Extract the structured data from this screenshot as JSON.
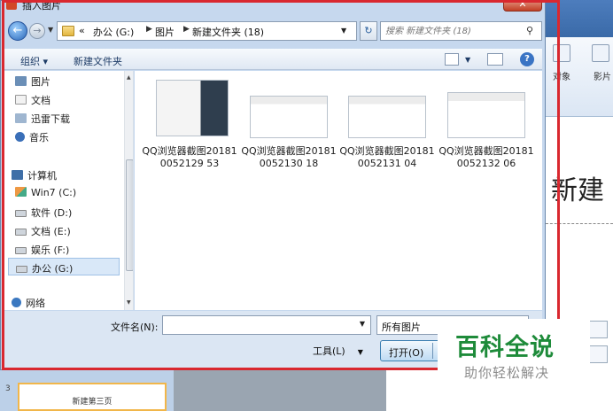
{
  "dialog": {
    "title": "插入图片",
    "close_glyph": "✕"
  },
  "address": {
    "overflow": "«",
    "crumbs": [
      "办公 (G:)",
      "图片",
      "新建文件夹 (18)"
    ],
    "search_placeholder": "搜索 新建文件夹 (18)"
  },
  "toolbar": {
    "organize": "组织 ▾",
    "new_folder": "新建文件夹",
    "help": "?"
  },
  "nav": {
    "items": [
      {
        "label": "图片",
        "icon": "pictures-icon"
      },
      {
        "label": "文档",
        "icon": "documents-icon"
      },
      {
        "label": "迅雷下载",
        "icon": "thunder-download-icon"
      },
      {
        "label": "音乐",
        "icon": "music-icon"
      },
      {
        "label": "计算机",
        "icon": "computer-icon"
      },
      {
        "label": "Win7 (C:)",
        "icon": "system-drive-icon"
      },
      {
        "label": "软件 (D:)",
        "icon": "drive-icon"
      },
      {
        "label": "文档 (E:)",
        "icon": "drive-icon"
      },
      {
        "label": "娱乐 (F:)",
        "icon": "drive-icon"
      },
      {
        "label": "办公 (G:)",
        "icon": "drive-icon"
      },
      {
        "label": "网络",
        "icon": "network-icon"
      }
    ]
  },
  "files": [
    {
      "name": "QQ浏览器截图201810052129 53"
    },
    {
      "name": "QQ浏览器截图201810052130 18"
    },
    {
      "name": "QQ浏览器截图201810052131 04"
    },
    {
      "name": "QQ浏览器截图201810052132 06"
    }
  ],
  "bottom": {
    "filename_label": "文件名(N):",
    "filename_value": "",
    "filetype_value": "所有图片",
    "tools_label": "工具(L)",
    "open_label": "打开(O)"
  },
  "background": {
    "ribbon_labels": [
      "对象",
      "影片"
    ],
    "slide_title": "新建",
    "slide_number": "3",
    "slide_thumb_text": "新建第三页"
  },
  "watermark": {
    "title": "百科全说",
    "subtitle": "助你轻松解决"
  },
  "colors": {
    "highlight_frame": "#d9282f",
    "watermark_green": "#1e8b3a"
  }
}
